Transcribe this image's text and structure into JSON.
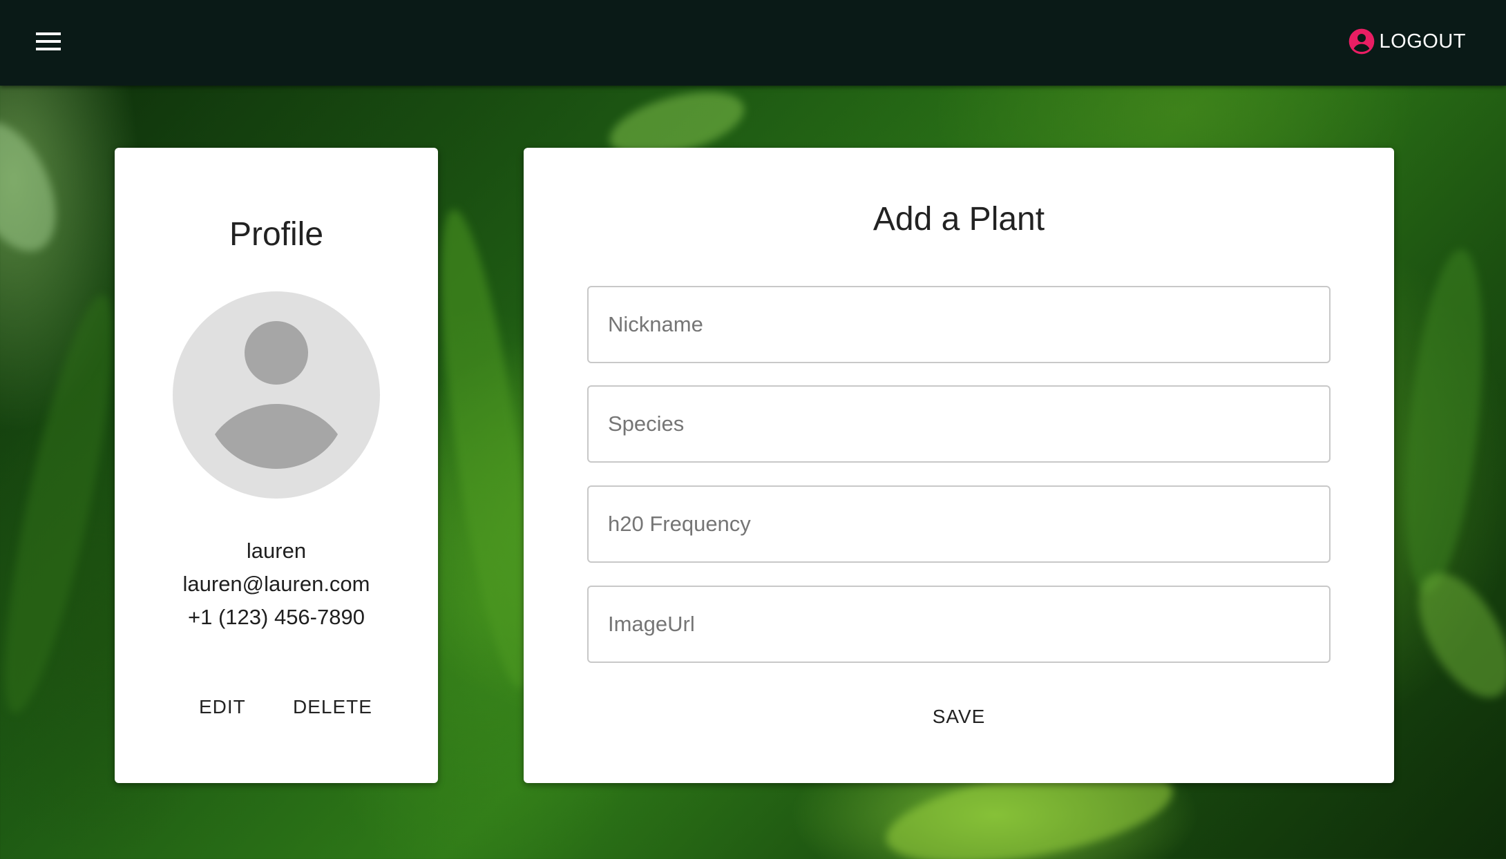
{
  "appbar": {
    "menu_icon": "hamburger-menu-icon",
    "logout_icon": "account-circle-icon",
    "logout_label": "LOGOUT",
    "accent_color": "#e91e63"
  },
  "profile": {
    "title": "Profile",
    "avatar_icon": "default-avatar-icon",
    "username": "lauren",
    "email": "lauren@lauren.com",
    "phone": "+1 (123) 456-7890",
    "edit_label": "EDIT",
    "delete_label": "DELETE"
  },
  "add_plant": {
    "title": "Add a Plant",
    "fields": [
      {
        "placeholder": "Nickname",
        "value": ""
      },
      {
        "placeholder": "Species",
        "value": ""
      },
      {
        "placeholder": "h20 Frequency",
        "value": ""
      },
      {
        "placeholder": "ImageUrl",
        "value": ""
      }
    ],
    "save_label": "SAVE"
  }
}
